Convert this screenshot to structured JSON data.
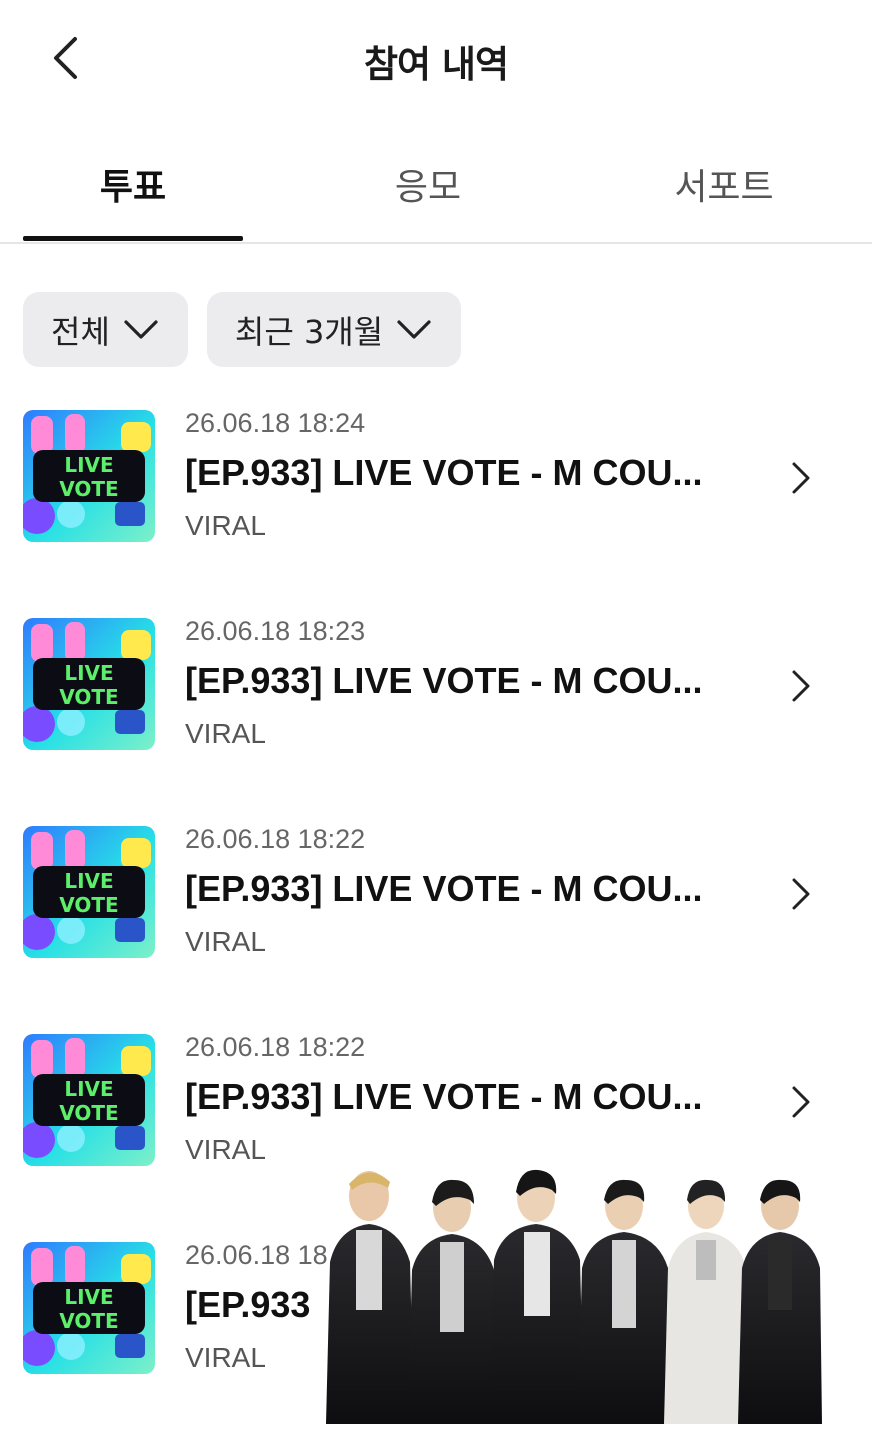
{
  "header": {
    "title": "참여 내역",
    "back_icon": "chevron-left-icon"
  },
  "tabs": [
    {
      "label": "투표",
      "active": true
    },
    {
      "label": "응모",
      "active": false
    },
    {
      "label": "서포트",
      "active": false
    }
  ],
  "filters": [
    {
      "label": "전체",
      "icon": "chevron-down-icon"
    },
    {
      "label": "최근 3개월",
      "icon": "chevron-down-icon"
    }
  ],
  "thumbnail": {
    "line1": "LIVE",
    "line2": "VOTE"
  },
  "items": [
    {
      "date": "26.06.18 18:24",
      "title": "[EP.933] LIVE VOTE - M COU...",
      "artist": "VIRAL"
    },
    {
      "date": "26.06.18 18:23",
      "title": "[EP.933] LIVE VOTE - M COU...",
      "artist": "VIRAL"
    },
    {
      "date": "26.06.18 18:22",
      "title": "[EP.933] LIVE VOTE - M COU...",
      "artist": "VIRAL"
    },
    {
      "date": "26.06.18 18:22",
      "title": "[EP.933] LIVE VOTE - M COU...",
      "artist": "VIRAL"
    },
    {
      "date": "26.06.18 18",
      "title": "[EP.933",
      "artist": "VIRAL"
    }
  ],
  "colors": {
    "text_primary": "#111111",
    "text_secondary": "#666666",
    "chip_bg": "#ececef",
    "divider": "#e6e6e6",
    "thumb_cyan": "#27e0e6",
    "thumb_blue": "#2f7bff",
    "thumb_pink": "#ff8ad8",
    "thumb_yellow": "#ffe94d"
  }
}
